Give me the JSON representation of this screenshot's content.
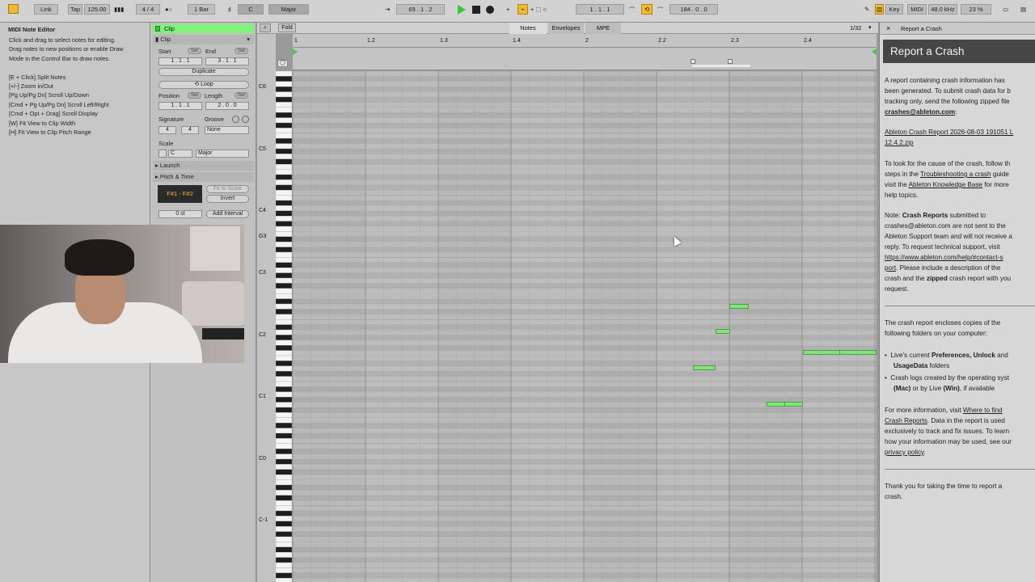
{
  "topbar": {
    "link": "Link",
    "tap": "Tap",
    "tempo": "125.00",
    "meter": "4 / 4",
    "quantize": "1 Bar",
    "key": "C",
    "scale": "Major",
    "position": "65 .  1 .  2",
    "loop_start": "1 .  1 .  1",
    "loop_length": "184 .  0 .  0",
    "key_button": "Key",
    "midi_button": "MIDI",
    "sample_rate": "48.0 kHz",
    "cpu": "23 %",
    "colors": {
      "accent": "#f2b92e",
      "play": "#36c837"
    }
  },
  "browser": {
    "title": "MIDI Note Editor",
    "lines": [
      "Click and drag to select notes for editing.",
      "Drag notes to new positions or enable Draw",
      "Mode in the Control Bar to draw notes.",
      "",
      "[E + Click] Split Notes",
      "[+/-] Zoom in/Out",
      "[Pg Up/Pg Dn] Scroll Up/Down",
      "[Cmd + Pg Up/Pg Dn] Scroll Left/Right",
      "[Cmd + Opt + Drag] Scroll Display",
      "[W] Fit View to Clip Width",
      "[H] Fit View to Clip Pitch Range"
    ]
  },
  "clip": {
    "clip_label": "Clip",
    "clip_section": "Clip",
    "start_label": "Start",
    "end_label": "End",
    "set": "Set",
    "start_value": "1 .  1 .  1",
    "end_value": "3 .  1 .  1",
    "duplicate": "Duplicate",
    "loop": "Loop",
    "position_label": "Position",
    "length_label": "Length",
    "position_value": "1 .  1 .  1",
    "length_value": "2 .  0 .  0",
    "signature_label": "Signature",
    "groove_label": "Groove",
    "sig_num": "4",
    "sig_den": "4",
    "groove_value": "None",
    "scale_label": "Scale",
    "scale_key": "C",
    "scale_mode": "Major",
    "launch": "Launch",
    "pitch_time": "Pitch & Time",
    "range": "F#1 - F#2",
    "fit_to_scale": "Fit to Scale",
    "invert": "Invert",
    "transpose": "0 st",
    "add_interval": "Add Interval"
  },
  "roll": {
    "notes_tab": "Notes",
    "envelopes_tab": "Envelopes",
    "mpe_tab": "MPE",
    "fold": "Fold",
    "grid": "1/32",
    "ruler": [
      "1",
      "1.2",
      "1.3",
      "1.4",
      "2",
      "2.2",
      "2.3",
      "2.4"
    ],
    "pitch_labels": [
      "C6",
      "C5",
      "C4",
      "G3",
      "C3",
      "C2",
      "C1",
      "C0",
      "C-1"
    ]
  },
  "crash": {
    "tab": "Report a Crash",
    "title": "Report a Crash",
    "p1": [
      "A report containing crash information has",
      "been generated. To submit crash data for b",
      "tracking only, send the following zipped file"
    ],
    "email": "crashes@ableton.com",
    "email_suffix": ":",
    "zip": [
      "Ableton Crash Report 2026-08-03 191051 L",
      "12.4.2.zip"
    ],
    "p2a": "To look for the cause of the crash, follow th",
    "p2b_pre": "steps in the ",
    "p2b_link": "Troubleshooting a crash",
    "p2b_post": " guide",
    "p2c_pre": "visit the ",
    "p2c_link": "Ableton Knowledge Base",
    "p2c_post": " for more",
    "p2d": "help topics.",
    "note_pre": "Note: ",
    "note_bold": "Crash Reports",
    "note_post": " submitted to",
    "note2": "crashes@ableton.com are not sent to the",
    "note3": "Ableton Support team and will not receive a",
    "note4": "reply. To request technical support, visit",
    "note_link1": "https://www.ableton.com/help/#contact-s",
    "note_link2": "port",
    "note5_post": ". Please include a description of the",
    "note6_pre": "crash and the ",
    "note6_bold": "zipped",
    "note6_post": " crash report with you",
    "note7": "request.",
    "p3a": "The crash report encloses copies of the",
    "p3b": "following folders on your computer:",
    "b1_pre": "Live's current ",
    "b1_bold": "Preferences, Unlock",
    "b1_post": " and",
    "b1_2bold": "UsageData",
    "b1_2post": " folders",
    "b2a": "Crash logs created by the operating syst",
    "b2b_pre": "(Mac)",
    "b2b_mid": " or by Live ",
    "b2b_bold": "(Win)",
    "b2b_post": ", if available",
    "p4_pre": "For more information, visit ",
    "p4_link": "Where to find",
    "p4b_link": "Crash Reports",
    "p4b_post": ". Data in the report is used",
    "p4c": "exclusively to track and fix issues. To learn",
    "p4d": "how your information may be used, see our",
    "p4e_link": "privacy policy",
    "p4e_post": ".",
    "thanks1": "Thank you for taking the time to report a",
    "thanks2": "crash."
  }
}
